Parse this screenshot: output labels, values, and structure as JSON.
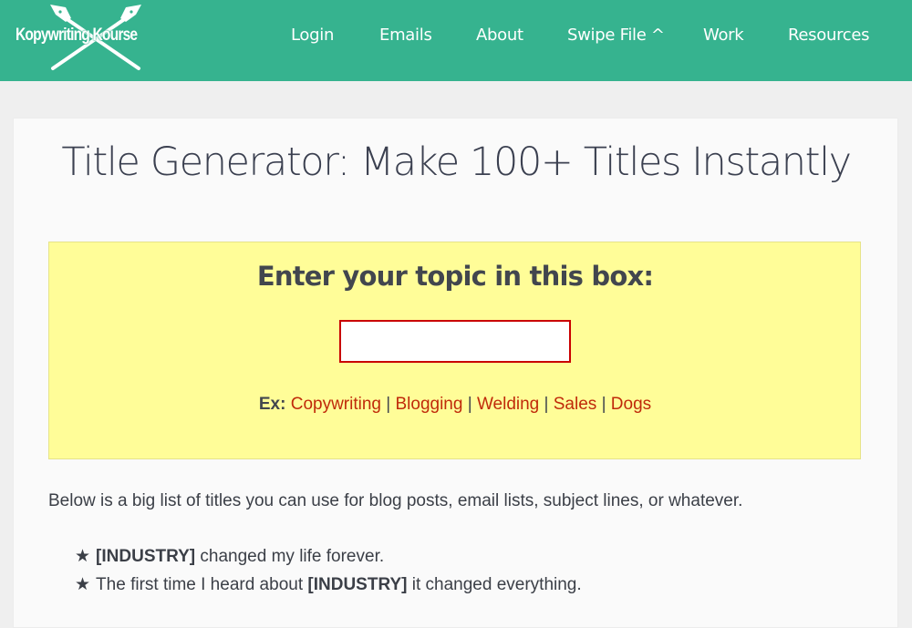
{
  "header": {
    "brand": "Kopywriting Kourse",
    "logo_icon": "crossed-pens-icon",
    "nav": [
      {
        "label": "Login"
      },
      {
        "label": "Emails"
      },
      {
        "label": "About"
      },
      {
        "label": "Swipe File ^"
      },
      {
        "label": "Work"
      },
      {
        "label": "Resources"
      }
    ],
    "colors": {
      "header_bg": "#36b38f",
      "nav_text": "#ffffff"
    }
  },
  "main": {
    "title": "Title Generator: Make 100+ Titles Instantly",
    "topic_box": {
      "heading": "Enter your topic in this box:",
      "input_value": "",
      "input_placeholder": "",
      "examples_label": "Ex:",
      "examples": [
        "Copywriting",
        "Blogging",
        "Welding",
        "Sales",
        "Dogs"
      ],
      "separator": "|",
      "colors": {
        "box_bg": "#fffd98",
        "input_border": "#c90000",
        "link": "#c02a0a"
      }
    },
    "intro": "Below is a big list of titles you can use for blog posts, email lists, subject lines, or whatever.",
    "bullet_icon": "star-icon",
    "bullet_glyph": "★",
    "titles": [
      {
        "before": "",
        "keyword": "[INDUSTRY]",
        "after": " changed my life forever."
      },
      {
        "before": "The first time I heard about ",
        "keyword": "[INDUSTRY]",
        "after": " it changed everything."
      }
    ]
  }
}
